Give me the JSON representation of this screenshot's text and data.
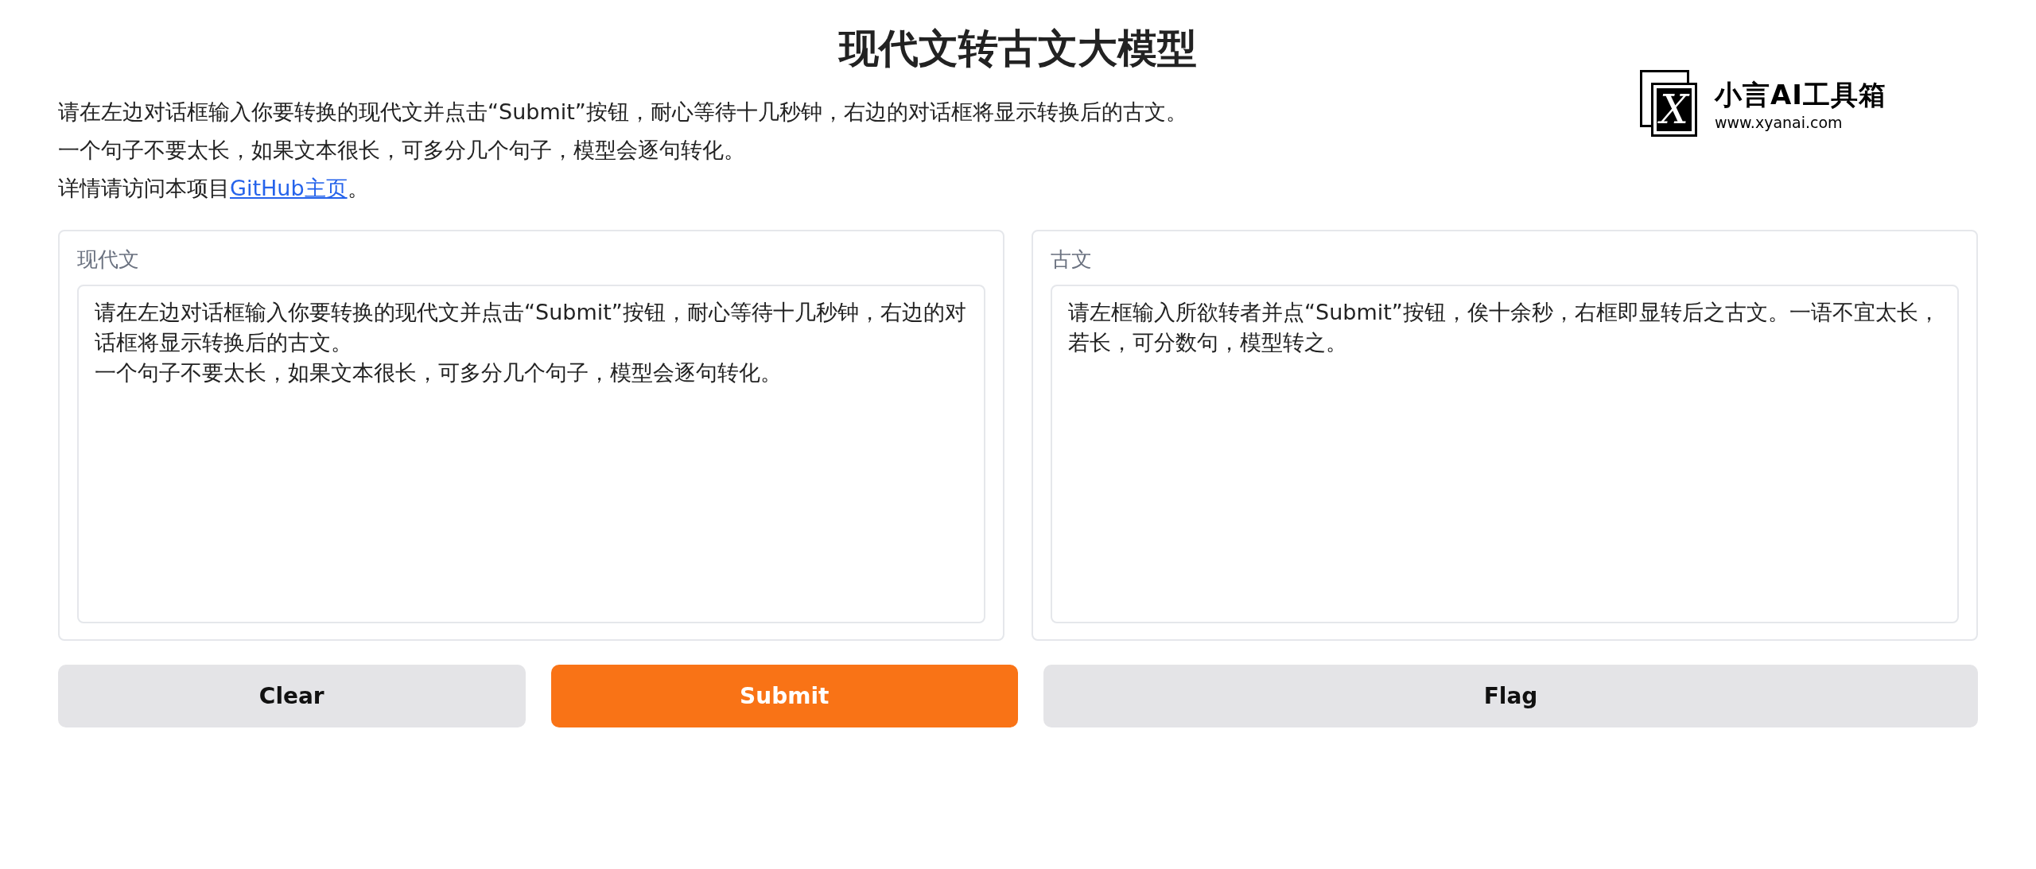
{
  "title": "现代文转古文大模型",
  "intro": {
    "lines": [
      "请在左边对话框输入你要转换的现代文并点击“Submit”按钮，耐心等待十几秒钟，右边的对话框将显示转换后的古文。",
      "一个句子不要太长，如果文本很长，可多分几个句子，模型会逐句转化。"
    ],
    "link_line": {
      "before": "详情请访问本项目",
      "link": "GitHub主页",
      "after": "。"
    }
  },
  "logo": {
    "mark": "X",
    "name": "小言AI工具箱",
    "url": "www.xyanai.com"
  },
  "panels": [
    {
      "label": "现代文",
      "paragraphs": [
        "请在左边对话框输入你要转换的现代文并点击“Submit”按钮，耐心等待十几秒钟，右边的对话框将显示转换后的古文。",
        "一个句子不要太长，如果文本很长，可多分几个句子，模型会逐句转化。"
      ]
    },
    {
      "label": "古文",
      "paragraphs": [
        "请左框输入所欲转者并点“Submit”按钮，俟十余秒，右框即显转后之古文。一语不宜太长，若长，可分数句，模型转之。"
      ]
    }
  ],
  "buttons": [
    {
      "label": "Clear",
      "kind": "secondary"
    },
    {
      "label": "Submit",
      "kind": "primary"
    },
    {
      "label": "Flag",
      "kind": "secondary"
    }
  ]
}
